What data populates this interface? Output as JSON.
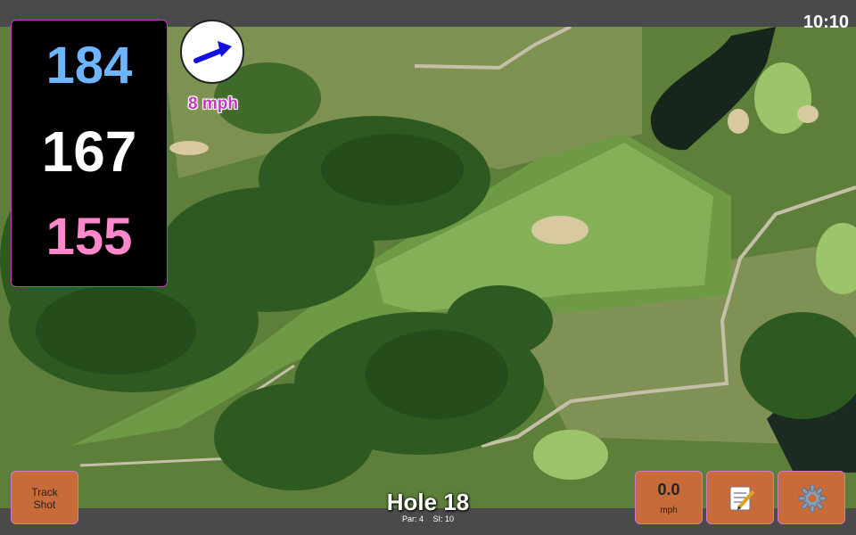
{
  "status": {
    "clock": "10:10"
  },
  "distances": {
    "back": "184",
    "middle": "167",
    "front": "155"
  },
  "wind": {
    "speed": "8 mph",
    "icon": "wind-arrow-icon"
  },
  "hole": {
    "title": "Hole 18",
    "par": "Par: 4",
    "stroke_index": "SI: 10"
  },
  "buttons": {
    "track_shot": [
      "Track",
      "Shot"
    ],
    "speed_value": "0.0",
    "speed_unit": "mph",
    "notes_icon": "notepad-icon",
    "settings_icon": "gear-icon"
  },
  "colors": {
    "back_yardage": "#6fb4ff",
    "middle_yardage": "#ffffff",
    "front_yardage": "#ff88cc",
    "button": "#c86b3a",
    "accent": "#c23dbd"
  }
}
